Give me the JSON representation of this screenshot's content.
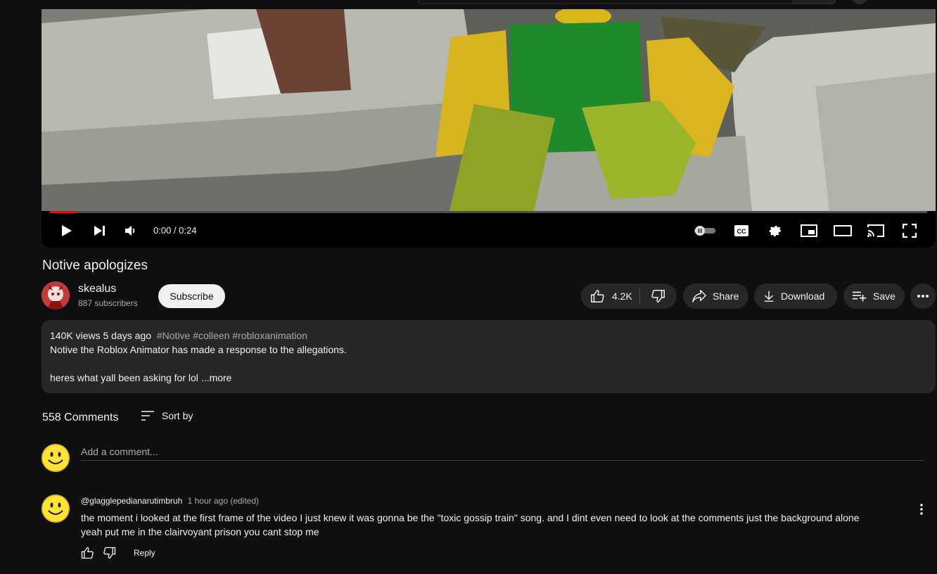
{
  "player": {
    "time_display": "0:00 / 0:24",
    "progress": 0.03,
    "colors": {
      "progress": "#ff0000"
    }
  },
  "video": {
    "title": "Notive apologizes"
  },
  "channel": {
    "name": "skealus",
    "subscribers": "887 subscribers",
    "subscribe_label": "Subscribe"
  },
  "actions": {
    "likes": "4.2K",
    "share_label": "Share",
    "download_label": "Download",
    "save_label": "Save"
  },
  "description": {
    "views": "140K views",
    "date": "5 days ago",
    "tags": "#Notive #colleen #robloxanimation",
    "line1": "Notive the Roblox Animator has made a response to the allegations.",
    "line2": "heres what yall been asking for lol",
    "more_label": "...more"
  },
  "comments": {
    "count": "558 Comments",
    "sort_label": "Sort by",
    "add_placeholder": "Add a comment...",
    "items": [
      {
        "author": "@glagglepedianarutimbruh",
        "time": "1 hour ago (edited)",
        "text": "the moment i looked at the first frame of the video I just knew it was gonna be the \"toxic gossip train\" song. and I dint even need to look at the comments just the background alone yeah put me in the clairvoyant prison you cant stop me",
        "reply_label": "Reply"
      }
    ]
  }
}
